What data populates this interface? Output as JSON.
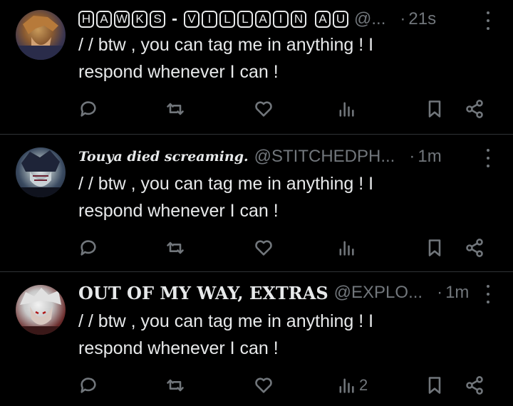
{
  "posts": [
    {
      "name": "HAWKS - VILLAIN AU",
      "name_boxes": [
        "H",
        "A",
        "W",
        "K",
        "S"
      ],
      "name_sep": "-",
      "name_boxes2": [
        "V",
        "I",
        "L",
        "L",
        "A",
        "I",
        "N"
      ],
      "name_boxes3": [
        "A",
        "U"
      ],
      "handle": "@...",
      "time": "21s",
      "text_line1": "/ /  btw ,  you can tag me in anything !  I",
      "text_line2": "respond whenever I can !",
      "views": ""
    },
    {
      "name": "Touya died screaming.",
      "handle": "@STITCHEDPH...",
      "time": "1m",
      "text_line1": "/ /  btw ,  you can tag me in anything !  I",
      "text_line2": "respond whenever I can !",
      "views": ""
    },
    {
      "name": "OUT OF MY WAY, EXTRAS",
      "handle": "@EXPLO...",
      "time": "1m",
      "text_line1": "/ /  btw ,  you can tag me in anything !  I",
      "text_line2": "respond whenever I can !",
      "views": "2"
    }
  ],
  "colors": {
    "background": "#000000",
    "text": "#e7e9ea",
    "muted": "#71767b",
    "divider": "#2f3336"
  }
}
